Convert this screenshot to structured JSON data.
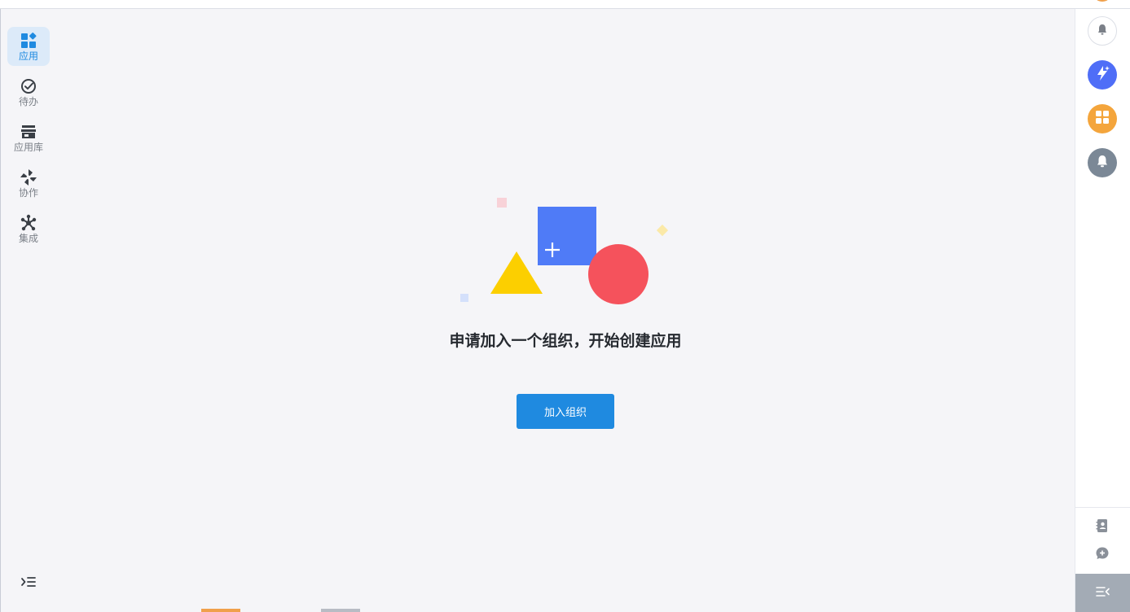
{
  "sidebar": {
    "items": [
      {
        "label": "应用",
        "icon": "apps-icon",
        "active": true
      },
      {
        "label": "待办",
        "icon": "check-circle-icon",
        "active": false
      },
      {
        "label": "应用库",
        "icon": "store-icon",
        "active": false
      },
      {
        "label": "协作",
        "icon": "pinwheel-icon",
        "active": false
      },
      {
        "label": "集成",
        "icon": "integration-icon",
        "active": false
      }
    ],
    "collapse_icon": "menu-collapse-icon"
  },
  "main": {
    "empty_title": "申请加入一个组织，开始创建应用",
    "join_button": "加入组织",
    "illustration_icon": "create-shapes-illustration"
  },
  "right_rail": {
    "buttons": [
      {
        "icon": "bell-outline-icon"
      },
      {
        "icon": "ai-spark-icon",
        "color": "#4f6ef7"
      },
      {
        "icon": "grid-apps-icon",
        "color": "#f4a53c"
      },
      {
        "icon": "bell-icon",
        "color": "#7b8896"
      }
    ],
    "small_buttons": [
      {
        "icon": "contacts-icon"
      },
      {
        "icon": "chat-add-icon"
      }
    ],
    "collapse_icon": "collapse-right-icon"
  },
  "colors": {
    "accent": "#1f8ae0",
    "background": "#f5f5f8",
    "shape_blue": "#4f7bf7",
    "shape_red": "#f5525c",
    "shape_yellow": "#fccf00"
  }
}
